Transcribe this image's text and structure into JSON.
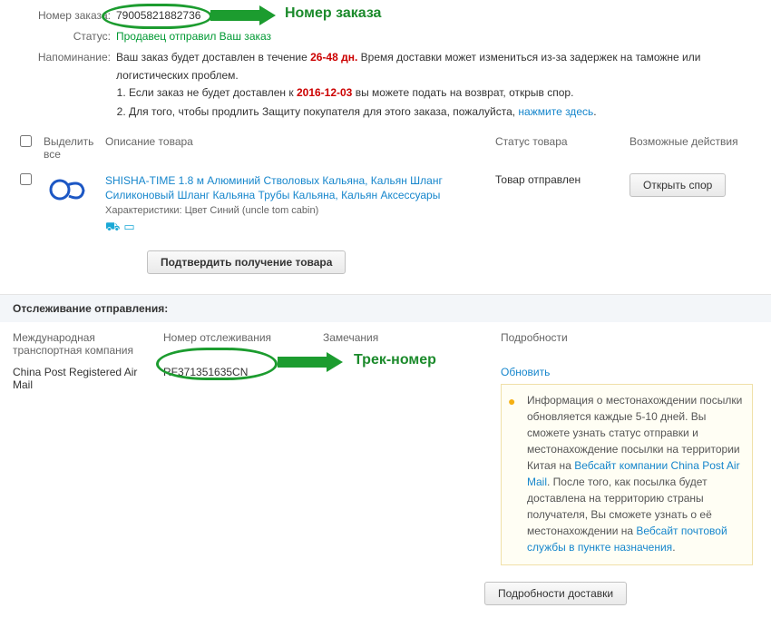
{
  "head": {
    "order_label": "Номер заказа:",
    "order_number": "79005821882736",
    "status_label": "Статус:",
    "status_value": "Продавец отправил Ваш заказ",
    "reminder_label": "Напоминание:",
    "reminder_prefix": "Ваш заказ будет доставлен в течение ",
    "reminder_days": "26-48 дн.",
    "reminder_tail": " Время доставки может измениться из-за задержек на таможне или логистических проблем.",
    "line1_prefix": "Если заказ не будет доставлен к ",
    "line1_date": "2016-12-03",
    "line1_tail": " вы можете подать на возврат, открыв спор.",
    "line2_prefix": "Для того, чтобы продлить Защиту покупателя для этого заказа, пожалуйста, ",
    "line2_link": "нажмите здесь"
  },
  "table": {
    "col_select": "Выделить все",
    "col_desc": "Описание товара",
    "col_status": "Статус товара",
    "col_actions": "Возможные действия",
    "row": {
      "product": "SHISHA-TIME 1.8 м Алюминий Стволовых Кальяна, Кальян Шланг Силиконовый Шланг Кальяна Трубы Кальяна, Кальян Аксессуары",
      "char": "Характеристики: Цвет Синий (uncle tom cabin)",
      "status": "Товар отправлен",
      "action_btn": "Открыть спор"
    },
    "confirm_btn": "Подтвердить получение товара"
  },
  "track": {
    "title": "Отслеживание отправления:",
    "h1": "Международная транспортная компания",
    "h2": "Номер отслеживания",
    "h3": "Замечания",
    "h4": "Подробности",
    "carrier": "China Post Registered Air Mail",
    "tracknum": "RF371351635CN",
    "remark": "",
    "refresh": "Обновить",
    "details_text1": "Информация о местонахождении посылки обновляется каждые 5-10 дней. Вы сможете узнать статус отправки и местонахождение посылки на территории Китая на ",
    "details_link1": "Вебсайт компании China Post Air Mail",
    "details_text2": ". После того, как посылка будет доставлена на территорию страны получателя, Вы сможете узнать о её местонахождении на ",
    "details_link2": "Вебсайт почтовой службы в пункте назначения",
    "details_tail": ".",
    "foot_btn": "Подробности доставки"
  },
  "annotations": {
    "order_label": "Номер заказа",
    "track_label": "Трек-номер"
  }
}
